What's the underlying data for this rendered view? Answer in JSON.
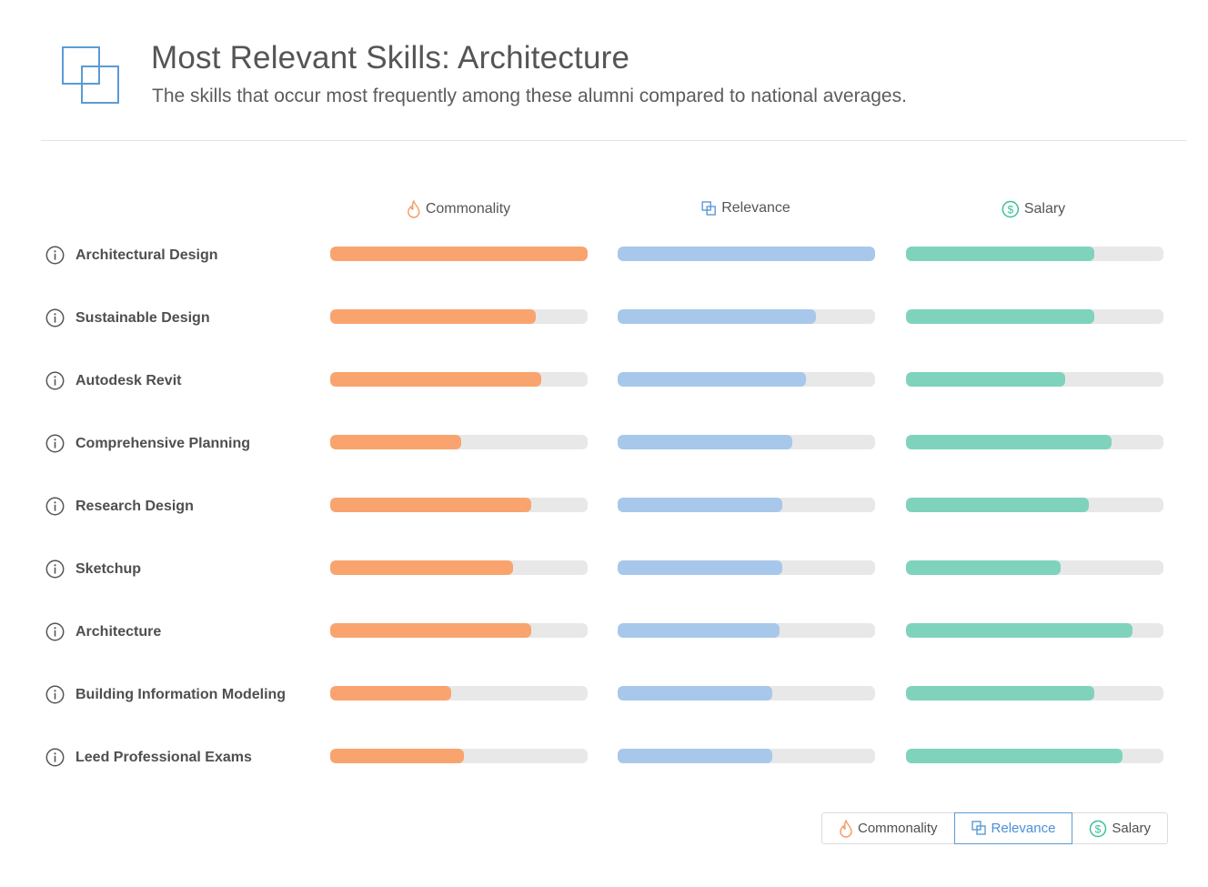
{
  "header": {
    "title": "Most Relevant Skills: Architecture",
    "subtitle": "The skills that occur most frequently among these alumni compared to national averages.",
    "logo_icon": "overlapping-squares-icon"
  },
  "colors": {
    "commonality": "#f9a46e",
    "relevance": "#a7c8ea",
    "salary": "#7fd3bd",
    "track": "#e8e8e8",
    "logo": "#5b9bd5",
    "active_toggle": "#4a90d9"
  },
  "columns": [
    {
      "key": "commonality",
      "label": "Commonality",
      "icon": "flame-icon"
    },
    {
      "key": "relevance",
      "label": "Relevance",
      "icon": "overlapping-squares-icon"
    },
    {
      "key": "salary",
      "label": "Salary",
      "icon": "dollar-circle-icon"
    }
  ],
  "toggle": {
    "options": [
      {
        "key": "commonality",
        "label": "Commonality",
        "icon": "flame-icon"
      },
      {
        "key": "relevance",
        "label": "Relevance",
        "icon": "overlapping-squares-icon"
      },
      {
        "key": "salary",
        "label": "Salary",
        "icon": "dollar-circle-icon"
      }
    ],
    "selected": "relevance"
  },
  "chart_data": {
    "type": "bar",
    "title": "Most Relevant Skills: Architecture",
    "subtitle": "The skills that occur most frequently among these alumni compared to national averages.",
    "orientation": "horizontal",
    "value_range": [
      0,
      1
    ],
    "categories": [
      "Architectural Design",
      "Sustainable Design",
      "Autodesk Revit",
      "Comprehensive Planning",
      "Research Design",
      "Sketchup",
      "Architecture",
      "Building Information Modeling",
      "Leed Professional Exams"
    ],
    "series": [
      {
        "name": "Commonality",
        "values": [
          1.0,
          0.8,
          0.82,
          0.51,
          0.78,
          0.71,
          0.78,
          0.47,
          0.52
        ]
      },
      {
        "name": "Relevance",
        "values": [
          1.0,
          0.77,
          0.73,
          0.68,
          0.64,
          0.64,
          0.63,
          0.6,
          0.6
        ]
      },
      {
        "name": "Salary",
        "values": [
          0.73,
          0.73,
          0.62,
          0.8,
          0.71,
          0.6,
          0.88,
          0.73,
          0.84
        ]
      }
    ]
  }
}
